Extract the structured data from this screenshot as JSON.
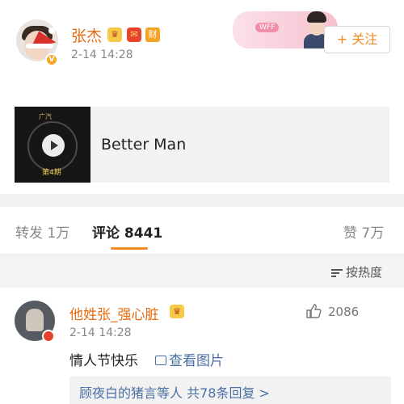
{
  "post": {
    "username": "张杰",
    "time": "2-14 14:28",
    "follow_label": "+ 关注",
    "badge_cai": "财",
    "banner_tag": "WFF",
    "media": {
      "title": "Better Man",
      "thumb_logo": "广汽",
      "thumb_episode": "第4期"
    }
  },
  "tabs": {
    "repost": "转发 1万",
    "comment": "评论 8441",
    "like": "赞 7万"
  },
  "sort": {
    "label": "按热度"
  },
  "comment": {
    "username": "他姓张_强心脏",
    "time": "2-14 14:28",
    "likes": "2086",
    "text": "情人节快乐",
    "image_link": "查看图片",
    "replies": "顾夜白的猪言等人  共78条回复 >"
  },
  "colors": {
    "username": "#e86b0f",
    "accent": "#f08a24",
    "link": "#4a6fa5"
  },
  "icons": [
    "santa-hat-icon",
    "verified-icon",
    "crown-icon",
    "red-envelope-icon",
    "play-icon",
    "sort-icon",
    "thumbs-up-icon",
    "image-icon"
  ]
}
